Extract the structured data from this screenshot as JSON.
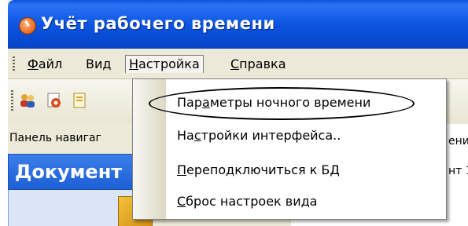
{
  "window": {
    "title": "Учёт рабочего времени"
  },
  "menubar": {
    "items": [
      {
        "label": "Файл",
        "hotkey_char": "Ф",
        "rest": "айл"
      },
      {
        "label": "Вид",
        "hotkey_char": "",
        "rest": "Вид"
      },
      {
        "label": "Настройка",
        "hotkey_char": "Н",
        "rest": "астройка"
      },
      {
        "label": "Справка",
        "hotkey_char": "С",
        "rest": "правка"
      }
    ]
  },
  "toolbar": {
    "icons": [
      "users-icon",
      "settings-icon",
      "document-icon"
    ]
  },
  "nav_panel": {
    "label": "Панель навигаг"
  },
  "documents_panel": {
    "title": "Документ"
  },
  "right_area": {
    "line1": "ение",
    "line2": "нт 1"
  },
  "dropdown": {
    "items": [
      {
        "pre": "Пар",
        "ul": "а",
        "post": "метры ночного времени"
      },
      {
        "pre": "На",
        "ul": "с",
        "post": "тройки интерфейса.."
      },
      {
        "pre": "",
        "ul": "П",
        "post": "ереподключиться к БД"
      },
      {
        "pre": "",
        "ul": "С",
        "post": "брос настроек вида"
      }
    ]
  },
  "colors": {
    "titlebar": "#0c55e2",
    "menu_bg": "#ece9d8",
    "doc_header": "#2a6ee0"
  }
}
